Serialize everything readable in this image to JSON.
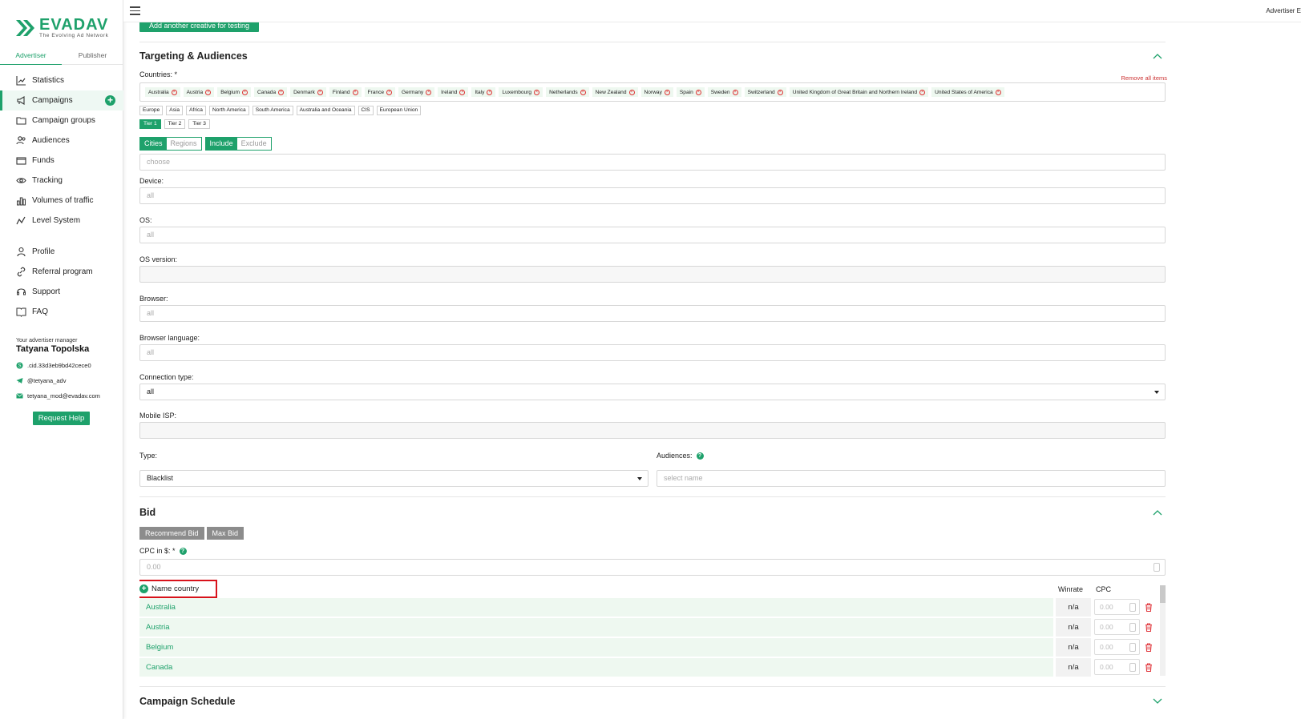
{
  "brand": {
    "name": "EVADAV",
    "tagline": "The Evolving Ad Network",
    "color": "#1ea16b"
  },
  "role_tabs": [
    {
      "label": "Advertiser",
      "active": true
    },
    {
      "label": "Publisher",
      "active": false
    }
  ],
  "nav": {
    "main": [
      {
        "label": "Statistics",
        "icon": "chart-icon"
      },
      {
        "label": "Campaigns",
        "icon": "megaphone-icon",
        "active": true
      },
      {
        "label": "Campaign groups",
        "icon": "folder-icon"
      },
      {
        "label": "Audiences",
        "icon": "users-icon"
      },
      {
        "label": "Funds",
        "icon": "wallet-icon"
      },
      {
        "label": "Tracking",
        "icon": "eye-icon"
      },
      {
        "label": "Volumes of traffic",
        "icon": "bar-chart-icon"
      },
      {
        "label": "Level System",
        "icon": "trend-icon"
      }
    ],
    "secondary": [
      {
        "label": "Profile",
        "icon": "user-icon"
      },
      {
        "label": "Referral program",
        "icon": "link-icon"
      },
      {
        "label": "Support",
        "icon": "headset-icon"
      },
      {
        "label": "FAQ",
        "icon": "book-icon"
      }
    ]
  },
  "manager": {
    "caption": "Your advertiser manager",
    "name": "Tatyana Topolska",
    "skype": ".cid.33d3eb9bd42cece0",
    "telegram": "@tetyana_adv",
    "email": "tetyana_mod@evadav.com",
    "help_label": "Request Help"
  },
  "topbar": {
    "right_text": "Advertiser E"
  },
  "main": {
    "add_creative_label": "Add another creative for testing",
    "targeting": {
      "title": "Targeting & Audiences",
      "countries_label": "Countries: *",
      "remove_all": "Remove all items",
      "countries": [
        "Australia",
        "Austria",
        "Belgium",
        "Canada",
        "Denmark",
        "Finland",
        "France",
        "Germany",
        "Ireland",
        "Italy",
        "Luxembourg",
        "Netherlands",
        "New Zealand",
        "Norway",
        "Spain",
        "Sweden",
        "Switzerland",
        "United Kingdom of Great Britain and Northern Ireland",
        "United States of America"
      ],
      "regions": [
        "Europe",
        "Asia",
        "Africa",
        "North America",
        "South America",
        "Australia and Oceania",
        "CIS",
        "European Union"
      ],
      "tiers": [
        {
          "label": "Tier 1",
          "active": true
        },
        {
          "label": "Tier 2",
          "active": false
        },
        {
          "label": "Tier 3",
          "active": false
        }
      ],
      "cities_label": "Cities",
      "regions_label": "Regions",
      "include_label": "Include",
      "exclude_label": "Exclude",
      "city_placeholder": "choose",
      "device_label": "Device:",
      "device_placeholder": "all",
      "os_label": "OS:",
      "os_placeholder": "all",
      "os_version_label": "OS version:",
      "browser_label": "Browser:",
      "browser_placeholder": "all",
      "browser_language_label": "Browser language:",
      "browser_language_placeholder": "all",
      "connection_label": "Connection type:",
      "connection_value": "all",
      "mobile_isp_label": "Mobile ISP:",
      "type_label": "Type:",
      "type_value": "Blacklist",
      "audiences_label": "Audiences:",
      "audiences_placeholder": "select name"
    },
    "bid": {
      "title": "Bid",
      "recommend_label": "Recommend Bid",
      "max_label": "Max Bid",
      "cpc_label": "CPC in $: *",
      "cpc_placeholder": "0.00",
      "name_country_label": "Name country",
      "winrate_header": "Winrate",
      "cpc_header": "CPC",
      "rows": [
        {
          "country": "Australia",
          "winrate": "n/a",
          "cpc_placeholder": "0.00"
        },
        {
          "country": "Austria",
          "winrate": "n/a",
          "cpc_placeholder": "0.00"
        },
        {
          "country": "Belgium",
          "winrate": "n/a",
          "cpc_placeholder": "0.00"
        },
        {
          "country": "Canada",
          "winrate": "n/a",
          "cpc_placeholder": "0.00"
        }
      ]
    },
    "schedule": {
      "title": "Campaign Schedule"
    }
  }
}
